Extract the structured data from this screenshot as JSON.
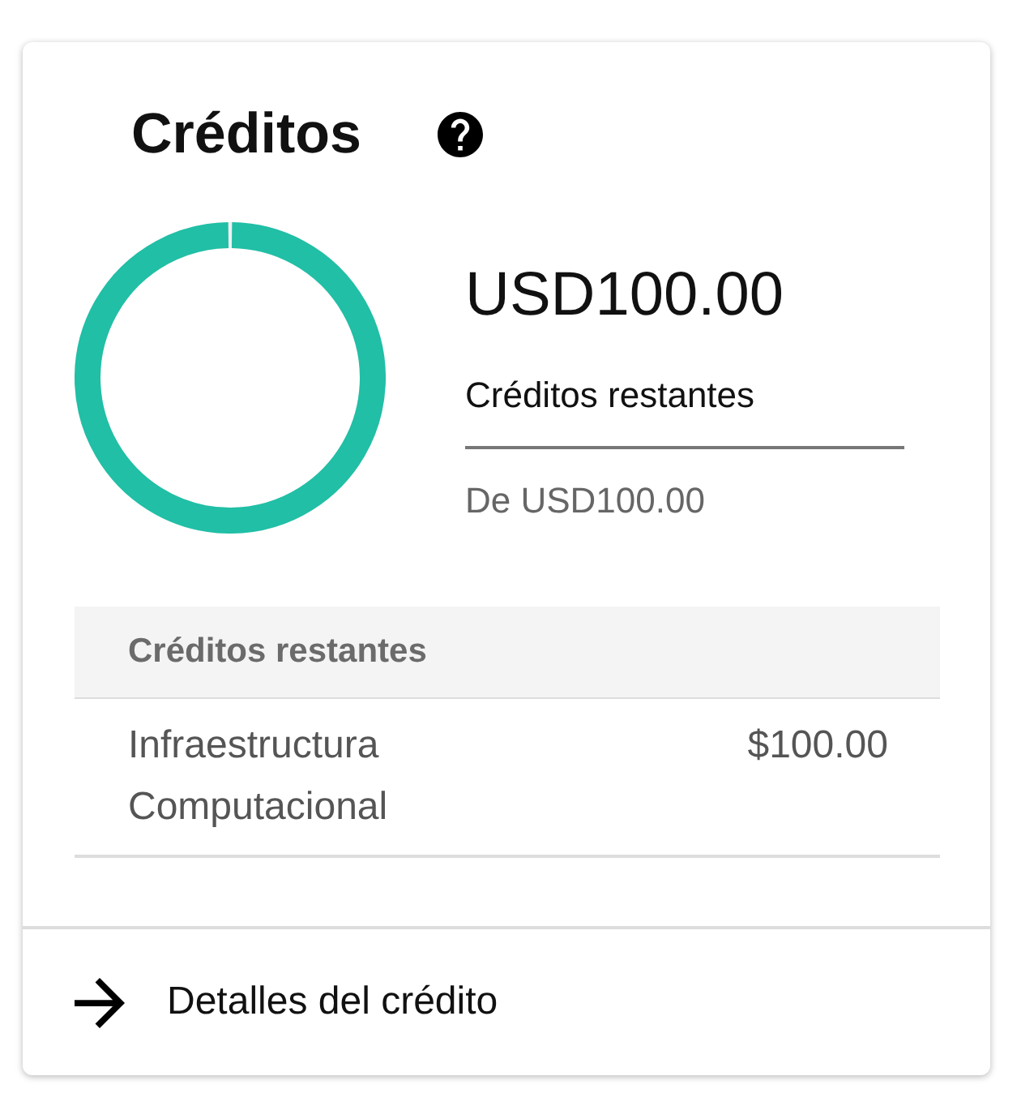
{
  "card": {
    "title": "Créditos"
  },
  "summary": {
    "amount": "USD100.00",
    "label": "Créditos restantes",
    "total": "De USD100.00",
    "level": 1
  },
  "table": {
    "header": "Créditos restantes",
    "rows": [
      {
        "name": "Infraestructura Computacional",
        "amount": "$100.00"
      }
    ]
  },
  "footer_link": {
    "label": "Detalles del crédito"
  }
}
